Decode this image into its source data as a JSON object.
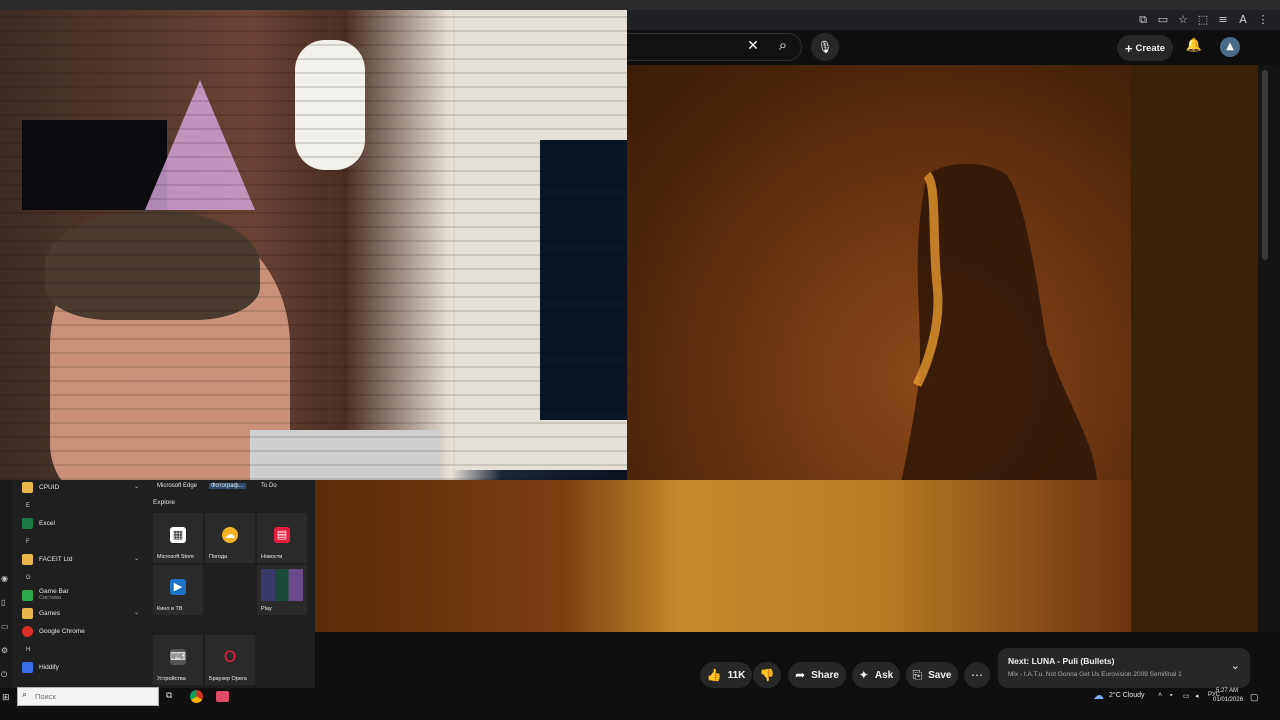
{
  "youtube": {
    "create_label": "Create",
    "actions": {
      "like_count": "11K",
      "share_label": "Share",
      "ask_label": "Ask",
      "save_label": "Save"
    },
    "next": {
      "title": "Next: LUNA - Puli (Bullets)",
      "subtitle": "Mix - t.A.T.u. Not Gonna Get Us Eurovision 2009 Semifinal 1"
    }
  },
  "start_menu": {
    "pinned_top": [
      "Microsoft Edge",
      "Фотограф...",
      "To Do"
    ],
    "explore_label": "Explore",
    "apps": [
      {
        "label": "CPUID",
        "icon_color": "#e8b84a"
      },
      {
        "letter": "E"
      },
      {
        "label": "Excel",
        "icon_color": "#1e7a45"
      },
      {
        "letter": "F"
      },
      {
        "label": "FACEIT Ltd",
        "icon_color": "#e8b84a"
      },
      {
        "letter": "G"
      },
      {
        "label": "Game Bar",
        "sub": "Система",
        "icon_color": "#2fa84f"
      },
      {
        "label": "Games",
        "icon_color": "#e8b84a"
      },
      {
        "label": "Google Chrome",
        "icon_color": "#d93025"
      },
      {
        "letter": "H"
      },
      {
        "label": "Hiddify",
        "icon_color": "#3a6ee8"
      }
    ],
    "tiles": {
      "store": "Microsoft Store",
      "weather": "Погода",
      "news": "Новости",
      "movies": "Кино и ТВ",
      "play": "Play",
      "devices": "Устройства",
      "opera": "Браузер Opera"
    }
  },
  "taskbar": {
    "search_placeholder": "Поиск",
    "weather": "2°C  Cloudy",
    "lang": "РУС",
    "time": "5:27 AM",
    "date": "01/01/2026"
  }
}
